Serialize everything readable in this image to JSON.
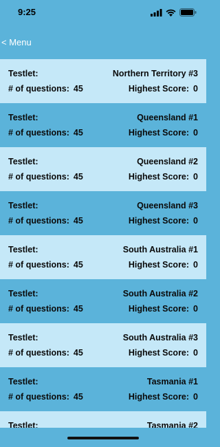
{
  "status": {
    "time": "9:25"
  },
  "nav": {
    "back_label": "< Menu"
  },
  "labels": {
    "testlet": "Testlet:",
    "questions": "# of questions:",
    "highest": "Highest Score:"
  },
  "colors": {
    "light_row": "#C5E8F8",
    "dark_row": "#5BB3DA"
  },
  "rows": [
    {
      "name": "Northern Territory #3",
      "questions": "45",
      "score": "0"
    },
    {
      "name": "Queensland #1",
      "questions": "45",
      "score": "0"
    },
    {
      "name": "Queensland #2",
      "questions": "45",
      "score": "0"
    },
    {
      "name": "Queensland #3",
      "questions": "45",
      "score": "0"
    },
    {
      "name": "South Australia #1",
      "questions": "45",
      "score": "0"
    },
    {
      "name": "South Australia #2",
      "questions": "45",
      "score": "0"
    },
    {
      "name": "South Australia #3",
      "questions": "45",
      "score": "0"
    },
    {
      "name": "Tasmania #1",
      "questions": "45",
      "score": "0"
    },
    {
      "name": "Tasmania #2"
    }
  ]
}
